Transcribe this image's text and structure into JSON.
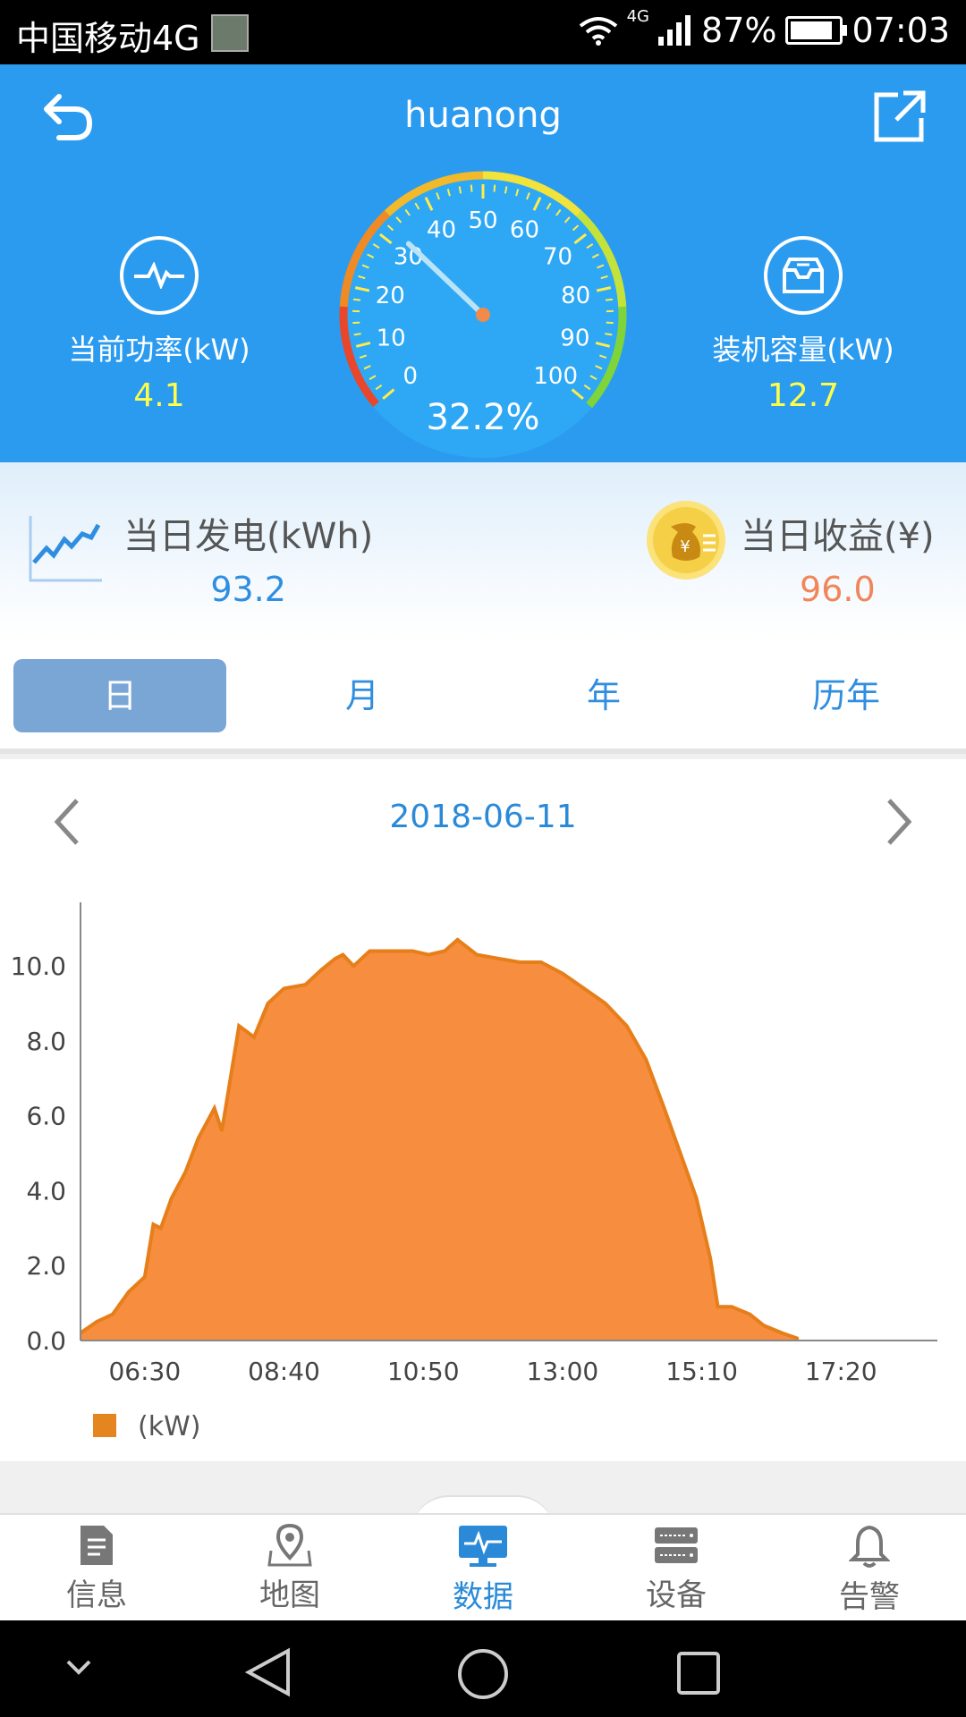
{
  "status_bar": {
    "carrier": "中国移动4G",
    "network": "4G",
    "battery": "87%",
    "time": "07:03"
  },
  "header": {
    "title": "huanong",
    "current_power": {
      "label": "当前功率(kW)",
      "value": "4.1"
    },
    "installed_capacity": {
      "label": "装机容量(kW)",
      "value": "12.7"
    }
  },
  "gauge": {
    "percent": 32.2,
    "percent_text": "32.2%",
    "ticks": [
      "0",
      "10",
      "20",
      "30",
      "40",
      "50",
      "60",
      "70",
      "80",
      "90",
      "100"
    ]
  },
  "daily": {
    "generation": {
      "label": "当日发电(kWh)",
      "value": "93.2"
    },
    "income": {
      "label": "当日收益(¥)",
      "value": "96.0"
    }
  },
  "tabs": [
    {
      "label": "日",
      "active": true
    },
    {
      "label": "月",
      "active": false
    },
    {
      "label": "年",
      "active": false
    },
    {
      "label": "历年",
      "active": false
    }
  ],
  "date_nav": {
    "date": "2018-06-11"
  },
  "chart_data": {
    "type": "area",
    "series": [
      {
        "name": "(kW)",
        "color": "#f78d3f"
      }
    ],
    "legend": "(kW)",
    "yticks": [
      "0.0",
      "2.0",
      "4.0",
      "6.0",
      "8.0",
      "10.0"
    ],
    "xticks": [
      "06:30",
      "08:40",
      "10:50",
      "13:00",
      "15:10",
      "17:20"
    ],
    "ylim": [
      0,
      11.7
    ],
    "xlim_minutes": [
      330,
      1130
    ],
    "points": [
      [
        330,
        0.2
      ],
      [
        345,
        0.5
      ],
      [
        360,
        0.7
      ],
      [
        375,
        1.3
      ],
      [
        390,
        1.7
      ],
      [
        398,
        3.1
      ],
      [
        405,
        3.0
      ],
      [
        415,
        3.8
      ],
      [
        428,
        4.5
      ],
      [
        440,
        5.4
      ],
      [
        455,
        6.2
      ],
      [
        462,
        5.6
      ],
      [
        470,
        7.0
      ],
      [
        478,
        8.4
      ],
      [
        492,
        8.1
      ],
      [
        505,
        9.0
      ],
      [
        520,
        9.4
      ],
      [
        540,
        9.5
      ],
      [
        555,
        9.9
      ],
      [
        568,
        10.2
      ],
      [
        575,
        10.3
      ],
      [
        585,
        10.0
      ],
      [
        600,
        10.4
      ],
      [
        620,
        10.4
      ],
      [
        640,
        10.4
      ],
      [
        655,
        10.3
      ],
      [
        670,
        10.4
      ],
      [
        682,
        10.7
      ],
      [
        700,
        10.3
      ],
      [
        720,
        10.2
      ],
      [
        740,
        10.1
      ],
      [
        760,
        10.1
      ],
      [
        780,
        9.8
      ],
      [
        800,
        9.4
      ],
      [
        820,
        9.0
      ],
      [
        840,
        8.4
      ],
      [
        858,
        7.5
      ],
      [
        875,
        6.2
      ],
      [
        890,
        5.0
      ],
      [
        905,
        3.8
      ],
      [
        918,
        2.2
      ],
      [
        925,
        0.9
      ],
      [
        938,
        0.9
      ],
      [
        955,
        0.7
      ],
      [
        968,
        0.4
      ],
      [
        985,
        0.2
      ],
      [
        1000,
        0.05
      ]
    ]
  },
  "bottom_nav": [
    {
      "label": "信息",
      "icon": "document-icon",
      "active": false
    },
    {
      "label": "地图",
      "icon": "map-pin-icon",
      "active": false
    },
    {
      "label": "数据",
      "icon": "monitor-icon",
      "active": true
    },
    {
      "label": "设备",
      "icon": "device-icon",
      "active": false
    },
    {
      "label": "告警",
      "icon": "bell-icon",
      "active": false
    }
  ]
}
